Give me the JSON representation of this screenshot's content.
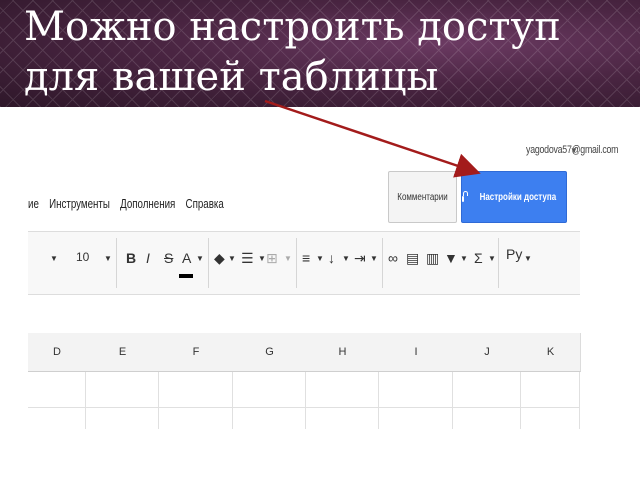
{
  "slide": {
    "title_line1": "Можно настроить доступ",
    "title_line2": "для вашей таблицы"
  },
  "account": {
    "email": "yagodova57@gmail.com"
  },
  "menu": {
    "items": [
      "ие",
      "Инструменты",
      "Дополнения",
      "Справка"
    ]
  },
  "buttons": {
    "comments": "Комментарии",
    "share": "Настройки доступа"
  },
  "toolbar": {
    "font_size": "10",
    "bold": "B",
    "italic": "I",
    "strike": "S",
    "text_color": "A",
    "sum": "Σ",
    "input_tools": "Ру"
  },
  "grid": {
    "columns": [
      "D",
      "E",
      "F",
      "G",
      "H",
      "I",
      "J",
      "K"
    ]
  },
  "colors": {
    "share_button": "#3d7ff0",
    "arrow": "#a31b1b",
    "banner": "#4a2542"
  }
}
